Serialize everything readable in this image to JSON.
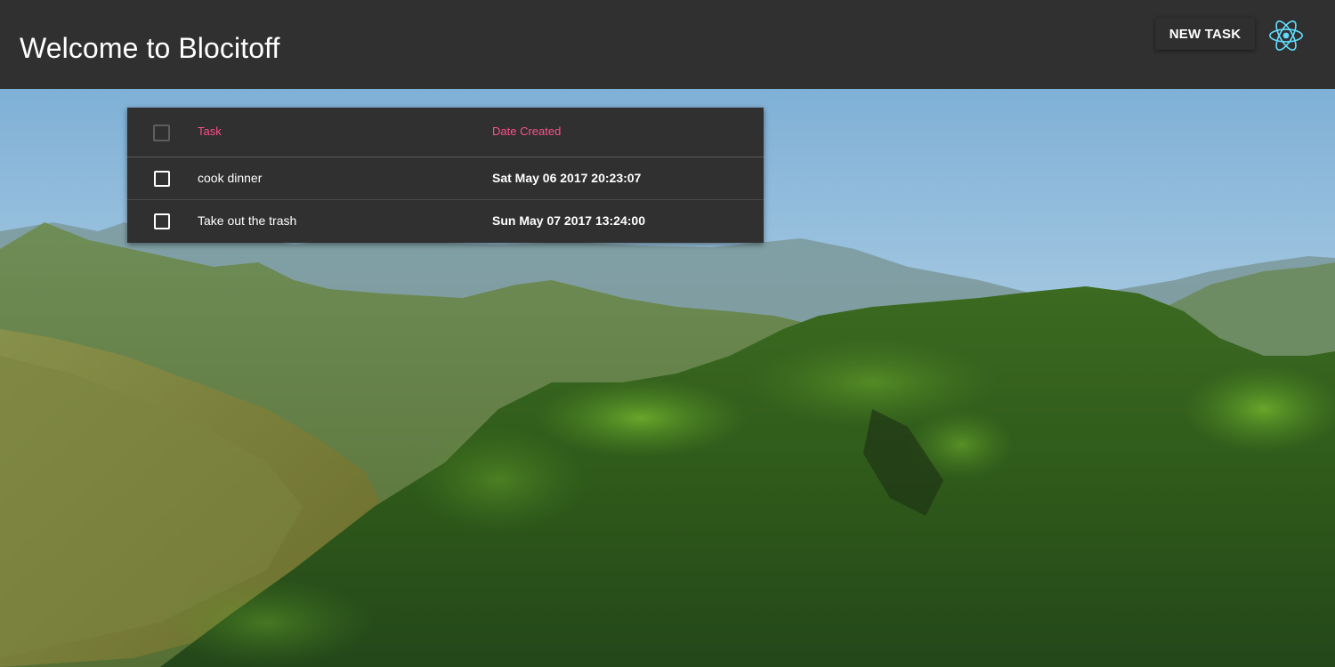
{
  "header": {
    "title": "Welcome to Blocitoff",
    "new_task_label": "NEW TASK",
    "logo_icon": "react-atom-icon"
  },
  "table": {
    "columns": [
      "Task",
      "Date Created"
    ],
    "rows": [
      {
        "task": "cook dinner",
        "date_created": "Sat May 06 2017 20:23:07",
        "checked": false
      },
      {
        "task": "Take out the trash",
        "date_created": "Sun May 07 2017 13:24:00",
        "checked": false
      }
    ]
  },
  "colors": {
    "app_bar": "#303030",
    "table_bg": "#303030",
    "header_accent": "#ff4f8b",
    "react_logo": "#61dafb"
  }
}
